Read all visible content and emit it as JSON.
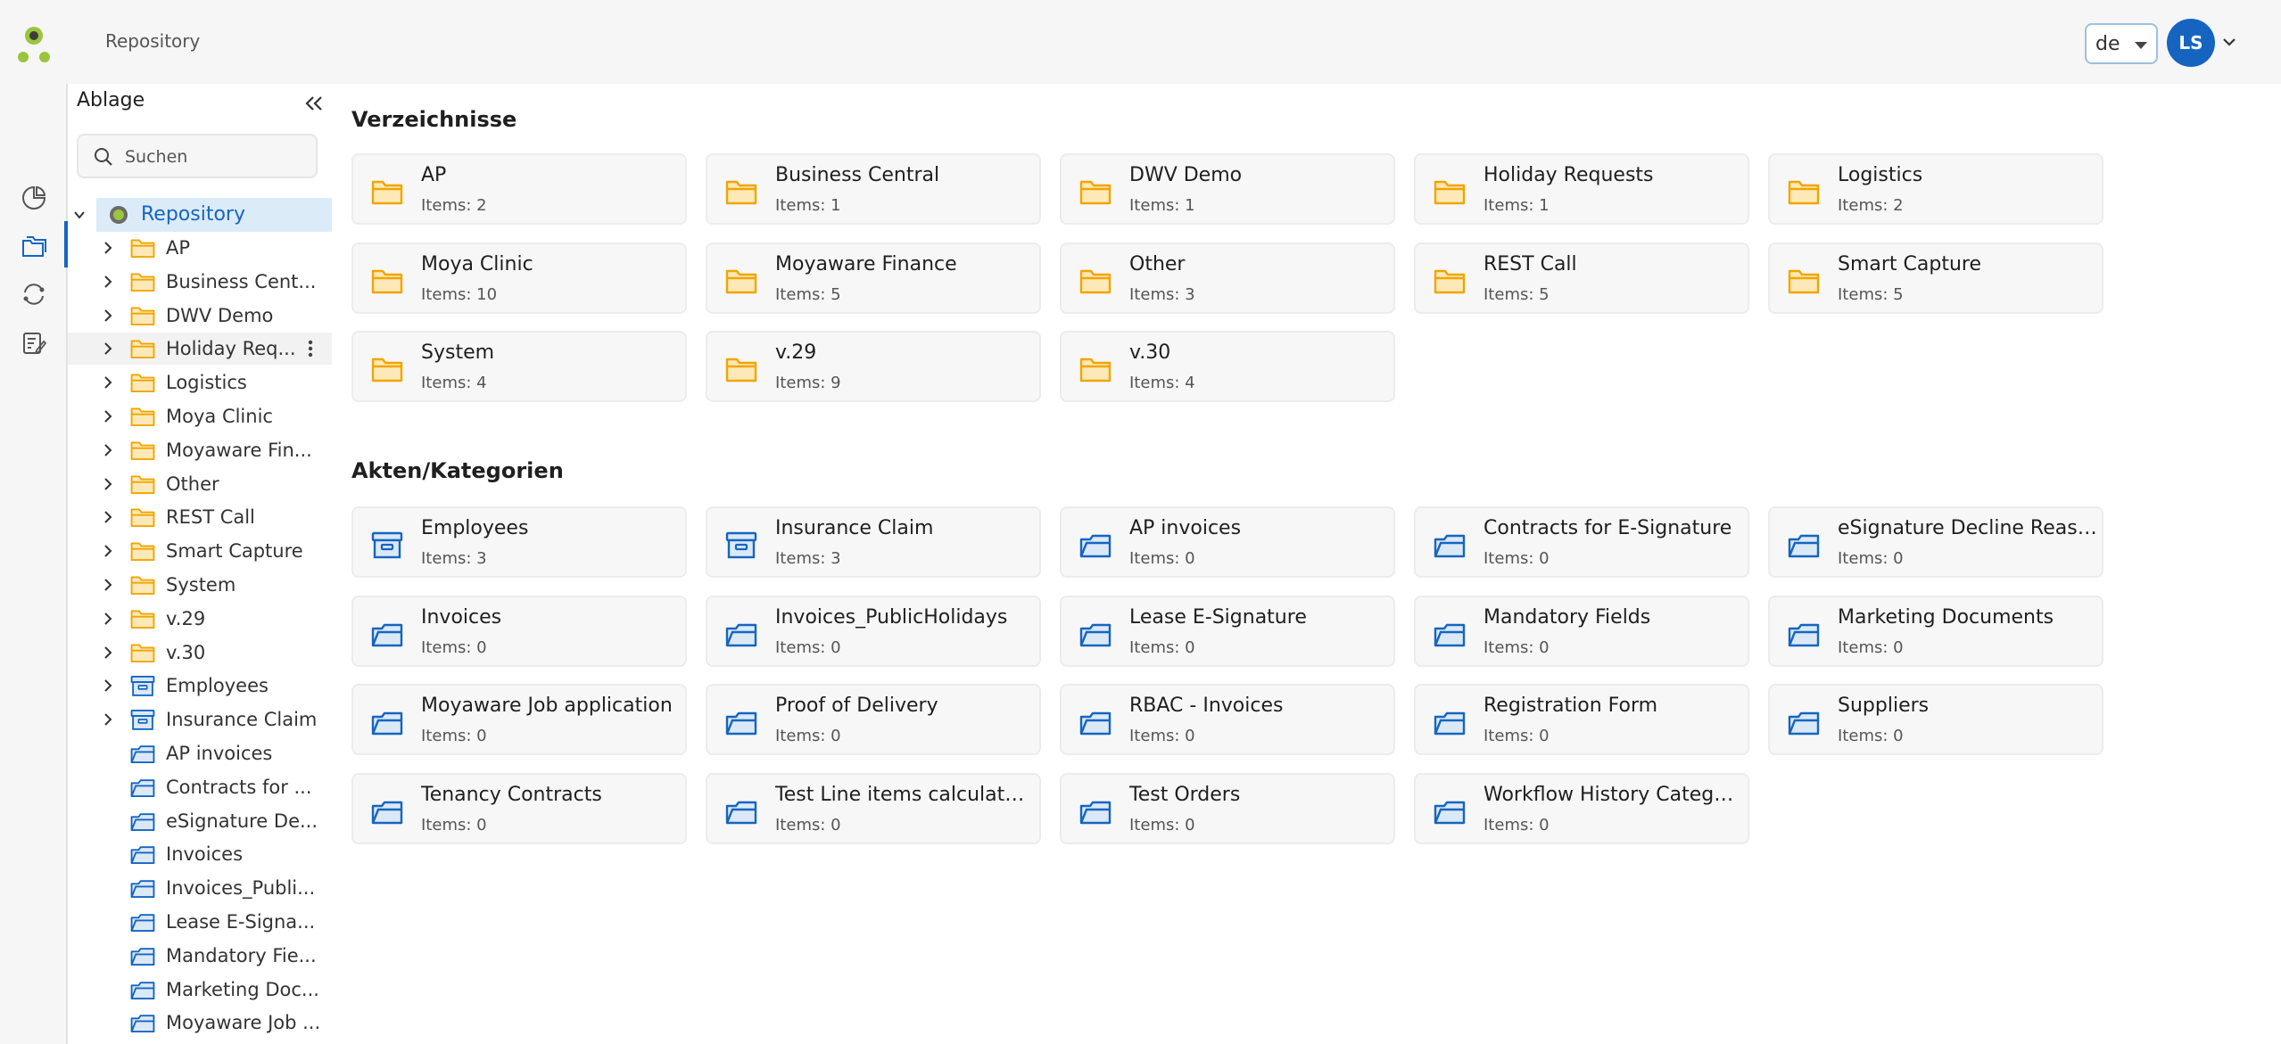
{
  "header": {
    "title": "Repository",
    "language": "de",
    "user_initials": "LS"
  },
  "rail": {
    "items": [
      "dashboard-icon",
      "folders-icon",
      "sync-icon",
      "tasks-icon"
    ]
  },
  "tree": {
    "title": "Ablage",
    "search_placeholder": "Suchen",
    "root_label": "Repository",
    "nodes": [
      {
        "label": "AP",
        "type": "folder",
        "expandable": true
      },
      {
        "label": "Business Cent...",
        "type": "folder",
        "expandable": true
      },
      {
        "label": "DWV Demo",
        "type": "folder",
        "expandable": true
      },
      {
        "label": "Holiday Req...",
        "type": "folder",
        "expandable": true
      },
      {
        "label": "Logistics",
        "type": "folder",
        "expandable": true
      },
      {
        "label": "Moya Clinic",
        "type": "folder",
        "expandable": true
      },
      {
        "label": "Moyaware Fin...",
        "type": "folder",
        "expandable": true
      },
      {
        "label": "Other",
        "type": "folder",
        "expandable": true
      },
      {
        "label": "REST Call",
        "type": "folder",
        "expandable": true
      },
      {
        "label": "Smart Capture",
        "type": "folder",
        "expandable": true
      },
      {
        "label": "System",
        "type": "folder",
        "expandable": true
      },
      {
        "label": "v.29",
        "type": "folder",
        "expandable": true
      },
      {
        "label": "v.30",
        "type": "folder",
        "expandable": true
      },
      {
        "label": "Employees",
        "type": "archive",
        "expandable": true
      },
      {
        "label": "Insurance Claim",
        "type": "archive",
        "expandable": true
      },
      {
        "label": "AP invoices",
        "type": "category",
        "expandable": false
      },
      {
        "label": "Contracts for ...",
        "type": "category",
        "expandable": false
      },
      {
        "label": "eSignature De...",
        "type": "category",
        "expandable": false
      },
      {
        "label": "Invoices",
        "type": "category",
        "expandable": false
      },
      {
        "label": "Invoices_Publi...",
        "type": "category",
        "expandable": false
      },
      {
        "label": "Lease E-Signa...",
        "type": "category",
        "expandable": false
      },
      {
        "label": "Mandatory Fie...",
        "type": "category",
        "expandable": false
      },
      {
        "label": "Marketing Doc...",
        "type": "category",
        "expandable": false
      },
      {
        "label": "Moyaware Job ...",
        "type": "category",
        "expandable": false
      }
    ]
  },
  "main": {
    "directories_title": "Verzeichnisse",
    "directories": [
      {
        "name": "AP",
        "count": "Items: 2"
      },
      {
        "name": "Business Central",
        "count": "Items: 1"
      },
      {
        "name": "DWV Demo",
        "count": "Items: 1"
      },
      {
        "name": "Holiday Requests",
        "count": "Items: 1"
      },
      {
        "name": "Logistics",
        "count": "Items: 2"
      },
      {
        "name": "Moya Clinic",
        "count": "Items: 10"
      },
      {
        "name": "Moyaware Finance",
        "count": "Items: 5"
      },
      {
        "name": "Other",
        "count": "Items: 3"
      },
      {
        "name": "REST Call",
        "count": "Items: 5"
      },
      {
        "name": "Smart Capture",
        "count": "Items: 5"
      },
      {
        "name": "System",
        "count": "Items: 4"
      },
      {
        "name": "v.29",
        "count": "Items: 9"
      },
      {
        "name": "v.30",
        "count": "Items: 4"
      }
    ],
    "categories_title": "Akten/Kategorien",
    "categories": [
      {
        "name": "Employees",
        "count": "Items: 3",
        "type": "archive"
      },
      {
        "name": "Insurance Claim",
        "count": "Items: 3",
        "type": "archive"
      },
      {
        "name": "AP invoices",
        "count": "Items: 0",
        "type": "category"
      },
      {
        "name": "Contracts for E-Signature",
        "count": "Items: 0",
        "type": "category"
      },
      {
        "name": "eSignature Decline Reason...",
        "count": "Items: 0",
        "type": "category"
      },
      {
        "name": "Invoices",
        "count": "Items: 0",
        "type": "category"
      },
      {
        "name": "Invoices_PublicHolidays",
        "count": "Items: 0",
        "type": "category"
      },
      {
        "name": "Lease E-Signature",
        "count": "Items: 0",
        "type": "category"
      },
      {
        "name": "Mandatory Fields",
        "count": "Items: 0",
        "type": "category"
      },
      {
        "name": "Marketing Documents",
        "count": "Items: 0",
        "type": "category"
      },
      {
        "name": "Moyaware Job application",
        "count": "Items: 0",
        "type": "category"
      },
      {
        "name": "Proof of Delivery",
        "count": "Items: 0",
        "type": "category"
      },
      {
        "name": "RBAC - Invoices",
        "count": "Items: 0",
        "type": "category"
      },
      {
        "name": "Registration Form",
        "count": "Items: 0",
        "type": "category"
      },
      {
        "name": "Suppliers",
        "count": "Items: 0",
        "type": "category"
      },
      {
        "name": "Tenancy Contracts",
        "count": "Items: 0",
        "type": "category"
      },
      {
        "name": "Test Line items calculated ...",
        "count": "Items: 0",
        "type": "category"
      },
      {
        "name": "Test Orders",
        "count": "Items: 0",
        "type": "category"
      },
      {
        "name": "Workflow History Category",
        "count": "Items: 0",
        "type": "category"
      }
    ]
  },
  "colors": {
    "accent": "#1565c0",
    "folder": "#f0a500",
    "folder_fill": "#fde9b8",
    "category": "#1565c0",
    "category_fill": "#dbe9f7",
    "logo_green": "#9bc53d"
  }
}
